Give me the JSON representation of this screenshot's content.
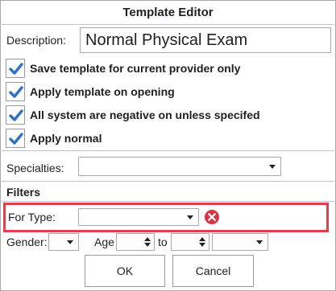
{
  "window": {
    "title": "Template Editor"
  },
  "description": {
    "label": "Description:",
    "value": "Normal Physical Exam"
  },
  "checkboxes": [
    {
      "label": "Save template for current provider only",
      "checked": true
    },
    {
      "label": "Apply template on opening",
      "checked": true
    },
    {
      "label": "All system are negative on unless specifed",
      "checked": true
    },
    {
      "label": "Apply normal",
      "checked": true
    }
  ],
  "specialties": {
    "label": "Specialties:",
    "value": ""
  },
  "filters": {
    "title": "Filters",
    "for_type": {
      "label": "For Type:",
      "value": ""
    },
    "gender": {
      "label": "Gender:",
      "value": ""
    },
    "age": {
      "label": "Age",
      "from": "",
      "to_label": "to",
      "to": "",
      "unit": ""
    }
  },
  "buttons": {
    "ok": "OK",
    "cancel": "Cancel"
  },
  "colors": {
    "highlight": "#e0404a",
    "check": "#2f72c4",
    "clear_icon": "#d9343f"
  }
}
